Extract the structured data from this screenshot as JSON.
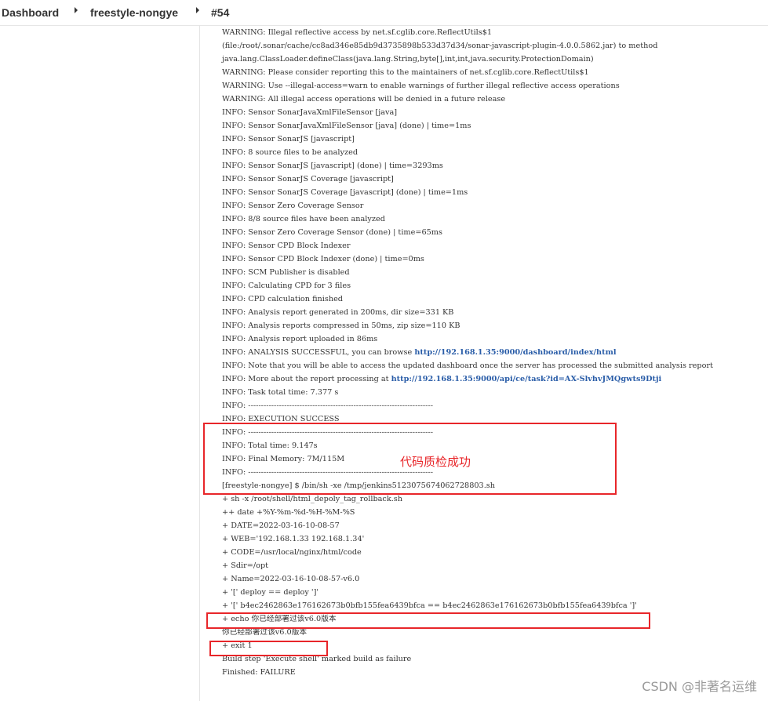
{
  "breadcrumb": {
    "items": [
      "Dashboard",
      "freestyle-nongye",
      "#54"
    ]
  },
  "console": {
    "lines": [
      {
        "text": "WARNING: Illegal reflective access by net.sf.cglib.core.ReflectUtils$1"
      },
      {
        "text": "(file:/root/.sonar/cache/cc8ad346e85db9d3735898b533d37d34/sonar-javascript-plugin-4.0.0.5862.jar) to method"
      },
      {
        "text": "java.lang.ClassLoader.defineClass(java.lang.String,byte[],int,int,java.security.ProtectionDomain)"
      },
      {
        "text": "WARNING: Please consider reporting this to the maintainers of net.sf.cglib.core.ReflectUtils$1"
      },
      {
        "text": "WARNING: Use --illegal-access=warn to enable warnings of further illegal reflective access operations"
      },
      {
        "text": "WARNING: All illegal access operations will be denied in a future release"
      },
      {
        "text": "INFO: Sensor SonarJavaXmlFileSensor [java]"
      },
      {
        "text": "INFO: Sensor SonarJavaXmlFileSensor [java] (done) | time=1ms"
      },
      {
        "text": "INFO: Sensor SonarJS [javascript]"
      },
      {
        "text": "INFO: 8 source files to be analyzed"
      },
      {
        "text": "INFO: Sensor SonarJS [javascript] (done) | time=3293ms"
      },
      {
        "text": "INFO: Sensor SonarJS Coverage [javascript]"
      },
      {
        "text": "INFO: Sensor SonarJS Coverage [javascript] (done) | time=1ms"
      },
      {
        "text": "INFO: Sensor Zero Coverage Sensor"
      },
      {
        "text": "INFO: 8/8 source files have been analyzed"
      },
      {
        "text": "INFO: Sensor Zero Coverage Sensor (done) | time=65ms"
      },
      {
        "text": "INFO: Sensor CPD Block Indexer"
      },
      {
        "text": "INFO: Sensor CPD Block Indexer (done) | time=0ms"
      },
      {
        "text": "INFO: SCM Publisher is disabled"
      },
      {
        "text": "INFO: Calculating CPD for 3 files"
      },
      {
        "text": "INFO: CPD calculation finished"
      },
      {
        "text": "INFO: Analysis report generated in 200ms, dir size=331 KB"
      },
      {
        "text": "INFO: Analysis reports compressed in 50ms, zip size=110 KB"
      },
      {
        "text": "INFO: Analysis report uploaded in 86ms"
      },
      {
        "text": "INFO: ANALYSIS SUCCESSFUL, you can browse ",
        "link": "http://192.168.1.35:9000/dashboard/index/html"
      },
      {
        "text": "INFO: Note that you will be able to access the updated dashboard once the server has processed the submitted analysis report",
        "wrap": true
      },
      {
        "text": "INFO: More about the report processing at ",
        "link": "http://192.168.1.35:9000/api/ce/task?id=AX-SlvhvJMQgwts9Dtji"
      },
      {
        "text": "INFO: Task total time: 7.377 s"
      },
      {
        "text": "INFO: ------------------------------------------------------------------------"
      },
      {
        "text": "INFO: EXECUTION SUCCESS"
      },
      {
        "text": "INFO: ------------------------------------------------------------------------"
      },
      {
        "text": "INFO: Total time: 9.147s"
      },
      {
        "text": "INFO: Final Memory: 7M/115M"
      },
      {
        "text": "INFO: ------------------------------------------------------------------------"
      },
      {
        "text": "[freestyle-nongye] $ /bin/sh -xe /tmp/jenkins5123075674062728803.sh"
      },
      {
        "text": "+ sh -x /root/shell/html_depoly_tag_rollback.sh"
      },
      {
        "text": "++ date +%Y-%m-%d-%H-%M-%S"
      },
      {
        "text": "+ DATE=2022-03-16-10-08-57"
      },
      {
        "text": "+ WEB='192.168.1.33 192.168.1.34'"
      },
      {
        "text": "+ CODE=/usr/local/nginx/html/code"
      },
      {
        "text": "+ Sdir=/opt"
      },
      {
        "text": "+ Name=2022-03-16-10-08-57-v6.0"
      },
      {
        "text": "+ '[' deploy == deploy ']'"
      },
      {
        "text": "+ '[' b4ec2462863e176162673b0bfb155fea6439bfca == b4ec2462863e176162673b0bfb155fea6439bfca ']'"
      },
      {
        "text": "+ echo 你已经部署过该v6.0版本"
      },
      {
        "text": "你已经部署过该v6.0版本"
      },
      {
        "text": "+ exit 1"
      },
      {
        "text": "Build step 'Execute shell' marked build as failure"
      },
      {
        "text": "Finished: FAILURE"
      }
    ]
  },
  "annotation": {
    "text": "代码质检成功",
    "color": "#e8262a"
  },
  "watermark": {
    "text": "CSDN @非著名运维"
  }
}
